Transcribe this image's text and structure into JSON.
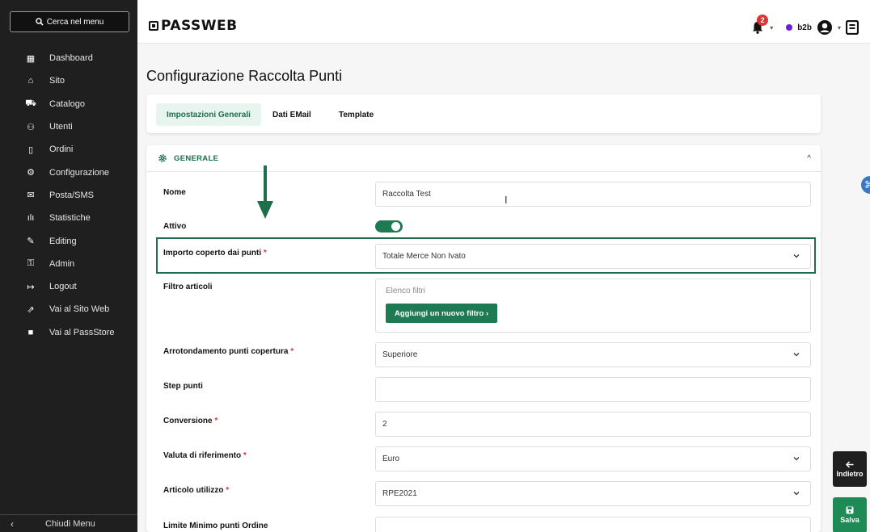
{
  "sidebar": {
    "search_label": "Cerca nel menu",
    "items": [
      {
        "label": "Dashboard",
        "icon": "grid-icon"
      },
      {
        "label": "Sito",
        "icon": "home-icon"
      },
      {
        "label": "Catalogo",
        "icon": "cart-icon"
      },
      {
        "label": "Utenti",
        "icon": "users-icon"
      },
      {
        "label": "Ordini",
        "icon": "document-icon"
      },
      {
        "label": "Configurazione",
        "icon": "gear-icon"
      },
      {
        "label": "Posta/SMS",
        "icon": "mail-icon"
      },
      {
        "label": "Statistiche",
        "icon": "bar-chart-icon"
      },
      {
        "label": "Editing",
        "icon": "pencil-icon"
      },
      {
        "label": "Admin",
        "icon": "lock-icon"
      },
      {
        "label": "Logout",
        "icon": "logout-icon"
      },
      {
        "label": "Vai al Sito Web",
        "icon": "external-link-icon"
      },
      {
        "label": "Vai al PassStore",
        "icon": "bag-icon"
      }
    ],
    "footer_label": "Chiudi Menu"
  },
  "header": {
    "logo": "PASSWEB",
    "notification_count": "2",
    "account_label": "b2b",
    "status_color": "#6a1fd6"
  },
  "page": {
    "title": "Configurazione Raccolta Punti",
    "tabs": [
      {
        "label": "Impostazioni Generali",
        "active": true
      },
      {
        "label": "Dati EMail",
        "active": false
      },
      {
        "label": "Template",
        "active": false
      }
    ],
    "section_title": "GENERALE",
    "fields": {
      "nome": {
        "label": "Nome",
        "value": "Raccolta Test"
      },
      "attivo": {
        "label": "Attivo",
        "value": true
      },
      "importo": {
        "label": "Importo coperto dai punti",
        "required": "*",
        "value": "Totale Merce Non Ivato"
      },
      "filtro": {
        "label": "Filtro articoli",
        "placeholder": "Elenco filtri",
        "button": "Aggiungi un nuovo filtro ›"
      },
      "arrotondamento": {
        "label": "Arrotondamento punti copertura",
        "required": "*",
        "value": "Superiore"
      },
      "step": {
        "label": "Step punti",
        "value": ""
      },
      "conversione": {
        "label": "Conversione",
        "required": "*",
        "value": "2"
      },
      "valuta": {
        "label": "Valuta di riferimento",
        "required": "*",
        "value": "Euro"
      },
      "articolo": {
        "label": "Articolo utilizzo",
        "required": "*",
        "value": "RPE2021"
      },
      "limite": {
        "label": "Limite Minimo punti Ordine",
        "value": ""
      }
    }
  },
  "actions": {
    "back_label": "Indietro",
    "save_label": "Salva"
  },
  "colors": {
    "accent": "#1e7a52",
    "sidebar_bg": "#1f1f1f"
  }
}
